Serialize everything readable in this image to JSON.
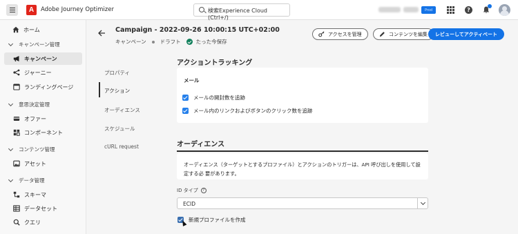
{
  "topbar": {
    "app_name": "Adobe Journey Optimizer",
    "logo_letter": "A",
    "search_placeholder": "検索Experience Cloud (Ctrl+/)",
    "org_blurred": "CJM Stage",
    "sandbox_blurred": "Prod (VA7)",
    "env_badge": "Prod"
  },
  "sidebar": {
    "home": "ホーム",
    "sections": [
      {
        "label": "キャンペーン管理",
        "items": [
          "キャンペーン",
          "ジャーニー",
          "ランディングページ"
        ]
      },
      {
        "label": "意思決定管理",
        "items": [
          "オファー",
          "コンポーネント"
        ]
      },
      {
        "label": "コンテンツ管理",
        "items": [
          "アセット"
        ]
      },
      {
        "label": "データ管理",
        "items": [
          "スキーマ",
          "データセット",
          "クエリ"
        ]
      }
    ]
  },
  "header": {
    "title": "Campaign - 2022-09-26 10:00:15 UTC+02:00",
    "breadcrumb_type": "キャンペーン",
    "status": "ドラフト",
    "saved": "たった今保存",
    "manage_access": "アクセスを管理",
    "edit_content": "コンテンツを編集",
    "review_activate": "レビューしてアクティベート"
  },
  "subnav": [
    "プロパティ",
    "アクション",
    "オーディエンス",
    "スケジュール",
    "cURL request"
  ],
  "action_tracking": {
    "title": "アクショントラッキング",
    "card_label": "メール",
    "checks": [
      "メールの開封数を追跡",
      "メール内のリンクおよびボタンのクリック数を追跡"
    ]
  },
  "audience": {
    "title": "オーディエンス",
    "description": "オーディエンス（ターゲットとするプロファイル）とアクションのトリガーは、API 呼び出しを使用して設定する必 要があります。",
    "id_type_label": "ID タイプ",
    "id_type_value": "ECID",
    "create_profile": "新規プロファイルを作成"
  },
  "colors": {
    "accent": "#1473e6",
    "brand": "#e1251b",
    "success": "#12805c"
  }
}
